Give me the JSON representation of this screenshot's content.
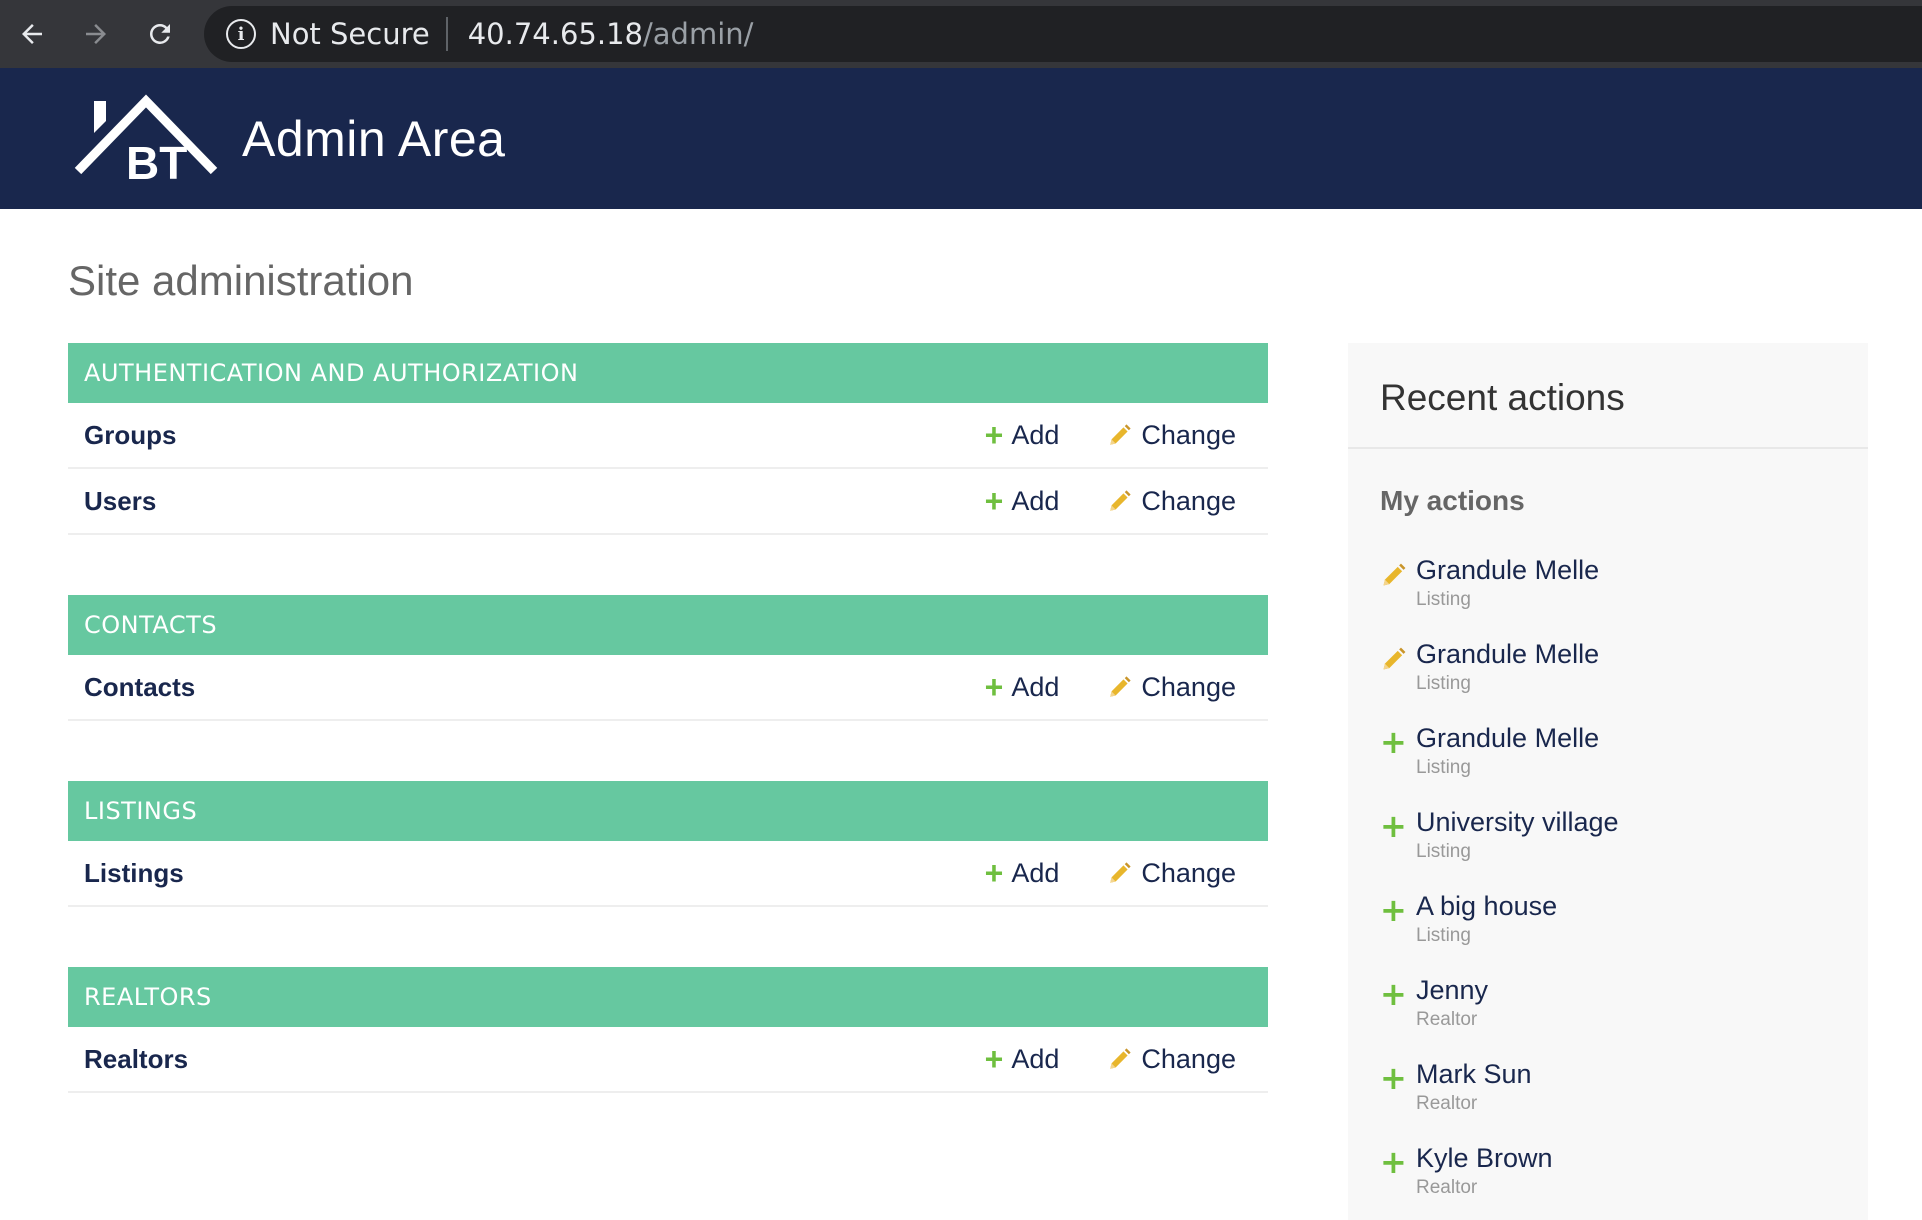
{
  "browser": {
    "security_label": "Not Secure",
    "url_host": "40.74.65.18",
    "url_path": "/admin/"
  },
  "header": {
    "logo_text": "BT",
    "title": "Admin Area"
  },
  "page": {
    "title": "Site administration"
  },
  "modules": [
    {
      "caption": "AUTHENTICATION AND AUTHORIZATION",
      "models": [
        {
          "name": "Groups",
          "add": "Add",
          "change": "Change"
        },
        {
          "name": "Users",
          "add": "Add",
          "change": "Change"
        }
      ]
    },
    {
      "caption": "CONTACTS",
      "models": [
        {
          "name": "Contacts",
          "add": "Add",
          "change": "Change"
        }
      ]
    },
    {
      "caption": "LISTINGS",
      "models": [
        {
          "name": "Listings",
          "add": "Add",
          "change": "Change"
        }
      ]
    },
    {
      "caption": "REALTORS",
      "models": [
        {
          "name": "Realtors",
          "add": "Add",
          "change": "Change"
        }
      ]
    }
  ],
  "sidebar": {
    "title": "Recent actions",
    "subtitle": "My actions",
    "actions": [
      {
        "kind": "change",
        "title": "Grandule Melle",
        "type": "Listing"
      },
      {
        "kind": "change",
        "title": "Grandule Melle",
        "type": "Listing"
      },
      {
        "kind": "add",
        "title": "Grandule Melle",
        "type": "Listing"
      },
      {
        "kind": "add",
        "title": "University village",
        "type": "Listing"
      },
      {
        "kind": "add",
        "title": "A big house",
        "type": "Listing"
      },
      {
        "kind": "add",
        "title": "Jenny",
        "type": "Realtor"
      },
      {
        "kind": "add",
        "title": "Mark Sun",
        "type": "Realtor"
      },
      {
        "kind": "add",
        "title": "Kyle Brown",
        "type": "Realtor"
      }
    ]
  },
  "colors": {
    "header_bg": "#19274d",
    "module_caption_bg": "#66c8a0",
    "add_icon": "#6fbf3f",
    "change_icon": "#e8b62c"
  }
}
